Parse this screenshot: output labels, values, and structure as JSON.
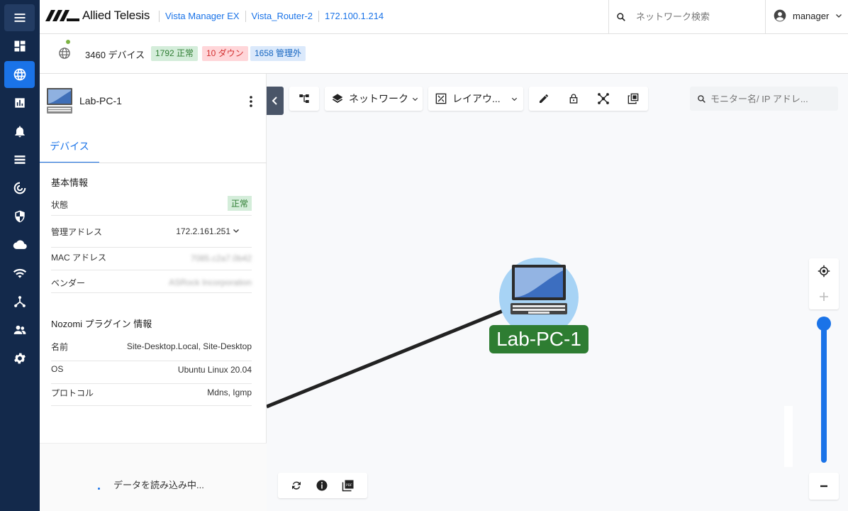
{
  "topbar": {
    "brand": "Allied Telesis",
    "breadcrumbs": [
      "Vista Manager EX",
      "Vista_Router-2",
      "172.100.1.214"
    ],
    "search_placeholder": "ネットワーク検索",
    "user": "manager"
  },
  "status": {
    "device_count": "3460 デバイス",
    "normal": "1792 正常",
    "down": "10 ダウン",
    "unmanaged": "1658 管理外",
    "colors": {
      "normal": "#2e7d32",
      "down": "#d32f2f",
      "unmanaged": "#1565c0"
    }
  },
  "rail": {
    "icons": [
      "menu-icon",
      "dashboard-icon",
      "globe-icon",
      "chart-icon",
      "alarm-icon",
      "list-icon",
      "radar-icon",
      "shield-icon",
      "cloud-icon",
      "wifi-icon",
      "topology-icon",
      "users-icon",
      "gear-icon"
    ],
    "active": "globe-icon"
  },
  "panel": {
    "device_name": "Lab-PC-1",
    "tab": "デバイス",
    "basic_title": "基本情報",
    "basic": [
      {
        "key": "状態",
        "value": "正常"
      },
      {
        "key": "管理アドレス",
        "value": "172.2.161.251"
      },
      {
        "key": "MAC アドレス",
        "value": "7085.c2a7.0b42"
      },
      {
        "key": "ベンダー",
        "value": "ASRock Incorporation"
      }
    ],
    "nozomi_title": "Nozomi プラグイン 情報",
    "nozomi": [
      {
        "key": "名前",
        "value": "Site-Desktop.Local, Site-Desktop"
      },
      {
        "key": "OS",
        "value": "Ubuntu Linux 20.04"
      },
      {
        "key": "プロトコル",
        "value": "Mdns, Igmp"
      }
    ],
    "loading": "データを読み込み中..."
  },
  "canvas": {
    "network_label": "ネットワーク",
    "layout_label": "レイアウ...",
    "search_placeholder": "モニター名/ IP アドレ...",
    "node_label": "Lab-PC-1",
    "zoom_level": 0.97
  }
}
